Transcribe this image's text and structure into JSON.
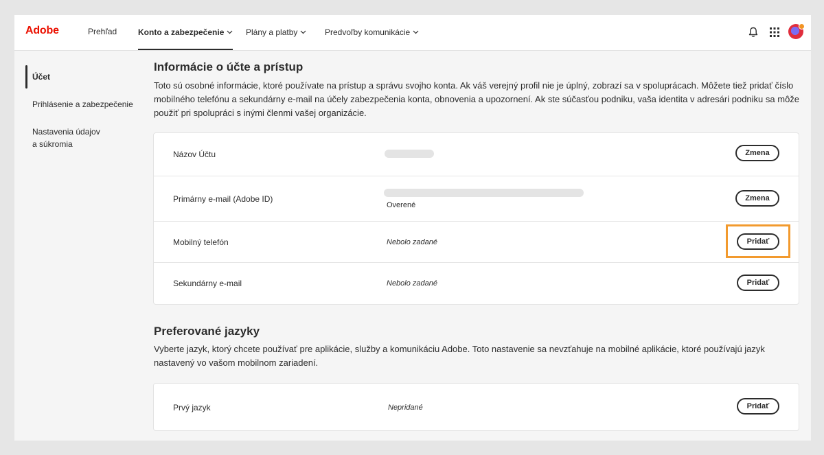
{
  "header": {
    "logo": "Adobe",
    "nav": [
      {
        "label": "Prehľad"
      },
      {
        "label": "Konto a zabezpečenie"
      },
      {
        "label": "Plány a platby"
      },
      {
        "label": "Predvoľby komunikácie"
      }
    ],
    "icons": [
      "bell-icon",
      "apps-grid-icon",
      "avatar"
    ]
  },
  "sidebar": {
    "items": [
      {
        "label": "Účet"
      },
      {
        "label": "Prihlásenie a zabezpečenie"
      },
      {
        "label": "Nastavenia údajov"
      },
      {
        "label": "a súkromia"
      }
    ]
  },
  "account": {
    "title": "Informácie o účte a prístup",
    "description": "Toto sú osobné informácie, ktoré používate na prístup a správu svojho konta. Ak váš verejný profil nie je úplný, zobrazí sa v spoluprácach. Môžete tiež pridať číslo mobilného telefónu a sekundárny e-mail na účely zabezpečenia konta, obnovenia a upozornení. Ak ste súčasťou podniku, vaša identita v adresári podniku sa môže použiť pri spolupráci s inými členmi vašej organizácie.",
    "rows": [
      {
        "label": "Názov Účtu",
        "value": "",
        "button": "Zmena"
      },
      {
        "label": "Primárny e-mail (Adobe ID)",
        "value": "",
        "sub": "Overené",
        "button": "Zmena"
      },
      {
        "label": "Mobilný telefón",
        "value": "Nebolo zadané",
        "button": "Pridať"
      },
      {
        "label": "Sekundárny e-mail",
        "value": "Nebolo zadané",
        "button": "Pridať"
      }
    ]
  },
  "languages": {
    "title": "Preferované jazyky",
    "description": "Vyberte jazyk, ktorý chcete používať pre aplikácie, služby a komunikáciu Adobe. Toto nastavenie sa nevzťahuje na mobilné aplikácie, ktoré používajú jazyk nastavený vo vašom mobilnom zariadení.",
    "rows": [
      {
        "label": "Prvý jazyk",
        "value": "Nepridané",
        "button": "Pridať"
      }
    ]
  },
  "colors": {
    "brand": "#eb1000",
    "highlight": "#f29a2e"
  }
}
